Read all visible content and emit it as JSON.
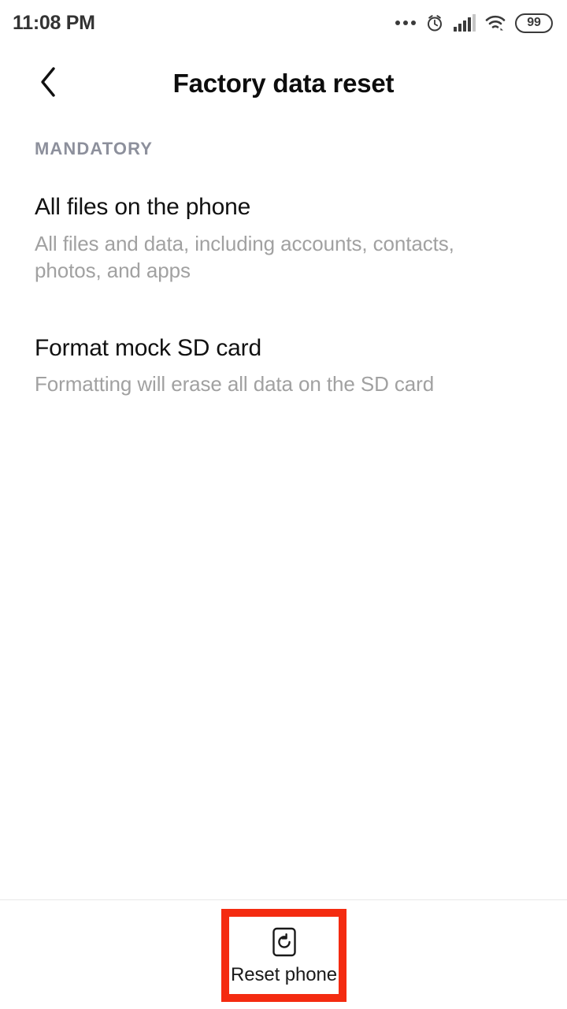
{
  "status_bar": {
    "time": "11:08 PM",
    "icons": [
      {
        "name": "more-dots-icon",
        "glyph": "dots"
      },
      {
        "name": "alarm-clock-icon",
        "glyph": "alarm"
      },
      {
        "name": "cellular-signal-icon",
        "glyph": "signal"
      },
      {
        "name": "wifi-icon",
        "glyph": "wifi"
      },
      {
        "name": "battery-icon",
        "glyph": "battery"
      }
    ],
    "battery_level": "99"
  },
  "title_bar": {
    "back_label": "Back",
    "title": "Factory data reset"
  },
  "content": {
    "section_header": "MANDATORY",
    "items": [
      {
        "title": "All files on the phone",
        "subtitle": "All files and data, including accounts, contacts, photos, and apps"
      },
      {
        "title": "Format mock SD card",
        "subtitle": "Formatting will erase all data on the SD card"
      }
    ]
  },
  "bottom_bar": {
    "reset_button_label": "Reset phone",
    "reset_button_icon": "restore-reset-icon",
    "highlight_color": "#f42b10"
  },
  "colors": {
    "background": "#ffffff",
    "primary_text": "#111111",
    "secondary_text": "#a1a1a1",
    "section_header_text": "#8d909c",
    "divider": "#e8e8e8",
    "highlight": "#f42b10"
  }
}
